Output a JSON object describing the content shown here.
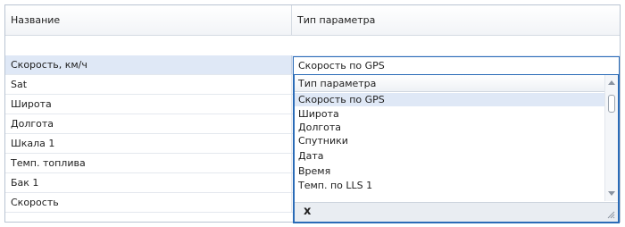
{
  "grid": {
    "columns": [
      "Название",
      "Тип параметра"
    ],
    "rows": [
      {
        "name": "Скорость, км/ч",
        "type": "Скорость по GPS"
      },
      {
        "name": "Sat",
        "type": ""
      },
      {
        "name": "Широта",
        "type": ""
      },
      {
        "name": "Долгота",
        "type": ""
      },
      {
        "name": "Шкала 1",
        "type": ""
      },
      {
        "name": "Темп. топлива",
        "type": ""
      },
      {
        "name": "Бак 1",
        "type": ""
      },
      {
        "name": "Скорость",
        "type": ""
      }
    ]
  },
  "dropdown": {
    "header": "Тип параметра",
    "items": [
      "Скорость по GPS",
      "Широта",
      "Долгота",
      "Спутники",
      "Дата",
      "Время",
      "Темп. по LLS  1"
    ],
    "selected": "Скорость по GPS",
    "close_glyph": "x"
  },
  "colors": {
    "accent": "#2a6bb7",
    "selection": "#dfe8f6",
    "grid_line": "#e4e8ee"
  }
}
